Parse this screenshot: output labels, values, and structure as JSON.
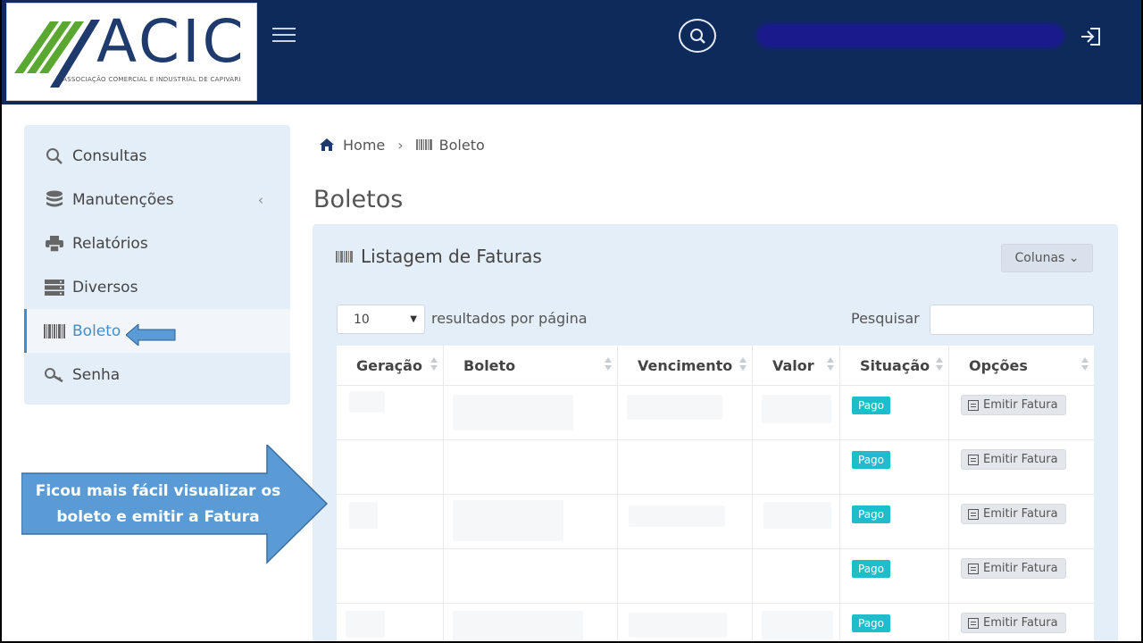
{
  "logo": {
    "text": "ACIC",
    "subtitle": "ASSOCIAÇÃO COMERCIAL E INDUSTRIAL DE CAPIVARI"
  },
  "colors": {
    "topbar": "#0e2a5a",
    "sidebar_bg": "#e3eef8",
    "accent": "#3b8fd0",
    "badge_paid": "#1fbccb",
    "callout": "#5b9bd5"
  },
  "icons": {
    "menu": "hamburger-icon",
    "search": "search-icon",
    "logout": "logout-icon",
    "home": "home-icon",
    "barcode": "barcode-icon"
  },
  "sidebar": {
    "items": [
      {
        "label": "Consultas",
        "icon": "search-icon"
      },
      {
        "label": "Manutenções",
        "icon": "database-icon",
        "chevron": "‹"
      },
      {
        "label": "Relatórios",
        "icon": "printer-icon"
      },
      {
        "label": "Diversos",
        "icon": "server-icon"
      },
      {
        "label": "Boleto",
        "icon": "barcode-icon",
        "active": true
      },
      {
        "label": "Senha",
        "icon": "key-icon"
      }
    ]
  },
  "breadcrumb": {
    "home": "Home",
    "separator": "›",
    "current": "Boleto"
  },
  "page": {
    "title": "Boletos"
  },
  "panel": {
    "title": "Listagem de Faturas",
    "columns_button": "Colunas ⌄",
    "page_length": "10",
    "page_length_label": "resultados por página",
    "search_label": "Pesquisar",
    "search_value": ""
  },
  "table": {
    "headers": [
      "Geração",
      "Boleto",
      "Vencimento",
      "Valor",
      "Situação",
      "Opções"
    ],
    "rows": [
      {
        "status": "Pago",
        "action": "Emitir Fatura"
      },
      {
        "status": "Pago",
        "action": "Emitir Fatura"
      },
      {
        "status": "Pago",
        "action": "Emitir Fatura"
      },
      {
        "status": "Pago",
        "action": "Emitir Fatura"
      },
      {
        "status": "Pago",
        "action": "Emitir Fatura"
      }
    ]
  },
  "callout": {
    "line1": "Ficou mais fácil visualizar os",
    "line2": "boleto e emitir a Fatura"
  }
}
